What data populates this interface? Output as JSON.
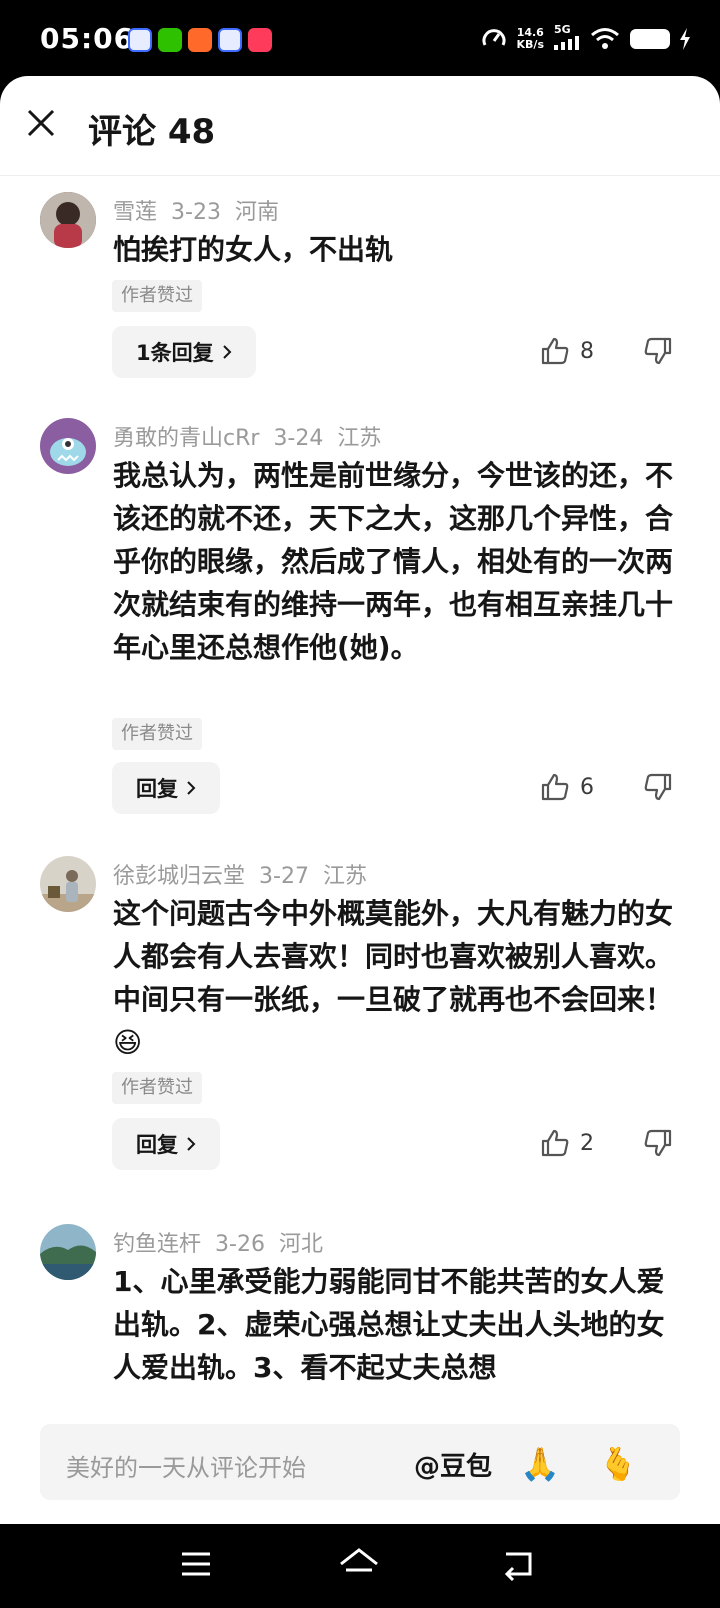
{
  "status_bar": {
    "time": "05:06",
    "speed_value": "14.6",
    "speed_unit": "KB/s",
    "network": "5G"
  },
  "header": {
    "title": "评论 48"
  },
  "comments": [
    {
      "user": "雪莲",
      "date": "3-23",
      "location": "河南",
      "text": "怕挨打的女人，不出轨",
      "liked_tag": "作者赞过",
      "reply_label": "1条回复",
      "likes": "8"
    },
    {
      "user": "勇敢的青山cRr",
      "date": "3-24",
      "location": "江苏",
      "text": "我总认为，两性是前世缘分，今世该的还，不该还的就不还，天下之大，这那几个异性，合乎你的眼缘，然后成了情人，相处有的一次两次就结束有的维持一两年，也有相互亲挂几十年心里还总想作他(她)。",
      "liked_tag": "作者赞过",
      "reply_label": "回复",
      "likes": "6"
    },
    {
      "user": "徐彭城归云堂",
      "date": "3-27",
      "location": "江苏",
      "text": "这个问题古今中外概莫能外，大凡有魅力的女人都会有人去喜欢！同时也喜欢被别人喜欢。中间只有一张纸，一旦破了就再也不会回来！😆",
      "liked_tag": "作者赞过",
      "reply_label": "回复",
      "likes": "2"
    },
    {
      "user": "钓鱼连杆",
      "date": "3-26",
      "location": "河北",
      "text": "1、心里承受能力弱能同甘不能共苦的女人爱出轨。2、虚荣心强总想让丈夫出人头地的女人爱出轨。3、看不起丈夫总想"
    }
  ],
  "input_bar": {
    "placeholder": "美好的一天从评论开始",
    "mention": "@豆包",
    "emoji_1": "🙏",
    "emoji_2": "🫰"
  },
  "colors": {
    "text_primary": "#161616",
    "text_secondary": "#9a9a9a",
    "chip_bg": "#f3f3f3",
    "bars": "#000000"
  }
}
